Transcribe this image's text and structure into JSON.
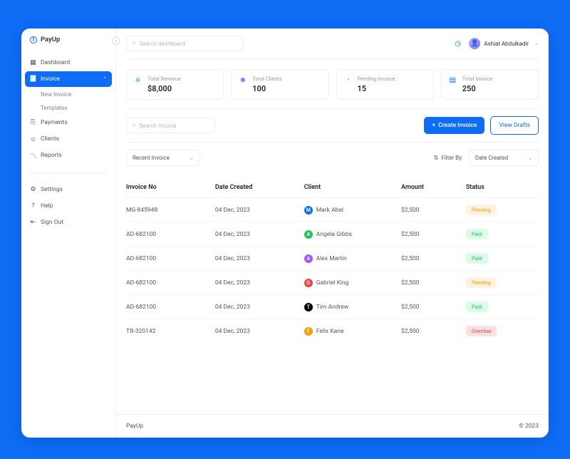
{
  "brand": "PayUp",
  "search": {
    "dashboard_placeholder": "Search dashboard",
    "invoice_placeholder": "Search Invoice"
  },
  "user": {
    "name": "Ashiat Abdulkadir"
  },
  "nav": {
    "dashboard": "Dashboard",
    "invoice": "Invoice",
    "sub": {
      "new": "New Invoice",
      "templates": "Templates"
    },
    "payments": "Payments",
    "clients": "Clients",
    "reports": "Reports",
    "settings": "Settings",
    "help": "Help",
    "signout": "Sign Out"
  },
  "stats": {
    "revenue": {
      "label": "Total Revenue",
      "value": "$8,000"
    },
    "clients": {
      "label": "Total Clients",
      "value": "100"
    },
    "pending": {
      "label": "Pending Invoice",
      "value": "15"
    },
    "total": {
      "label": "Total Invoice",
      "value": "250"
    }
  },
  "buttons": {
    "create": "Create Invoice",
    "drafts": "View Drafts"
  },
  "filters": {
    "recent": "Recent Invoice",
    "filter_by": "Filter By:",
    "date_created": "Date Created"
  },
  "table": {
    "headers": {
      "no": "Invoice No",
      "date": "Date Created",
      "client": "Client",
      "amount": "Amount",
      "status": "Status"
    },
    "rows": [
      {
        "no": "MG-845948",
        "date": "04 Dec, 2023",
        "client": "Mark Abel",
        "initial": "M",
        "avcls": "av-m",
        "amount": "$2,500",
        "status": "Pending",
        "statuscls": "badge-pending"
      },
      {
        "no": "AD-682100",
        "date": "04 Dec, 2023",
        "client": "Angela Gibbs",
        "initial": "A",
        "avcls": "av-a",
        "amount": "$2,500",
        "status": "Paid",
        "statuscls": "badge-paid"
      },
      {
        "no": "AD-682100",
        "date": "04 Dec, 2023",
        "client": "Alex Martin",
        "initial": "A",
        "avcls": "av-x",
        "amount": "$2,500",
        "status": "Paid",
        "statuscls": "badge-paid"
      },
      {
        "no": "AD-682100",
        "date": "04 Dec, 2023",
        "client": "Gabriel King",
        "initial": "G",
        "avcls": "av-g",
        "amount": "$2,500",
        "status": "Pending",
        "statuscls": "badge-pending"
      },
      {
        "no": "AD-682100",
        "date": "04 Dec, 2023",
        "client": "Tim Andrew",
        "initial": "T",
        "avcls": "av-t",
        "amount": "$2,500",
        "status": "Paid",
        "statuscls": "badge-paid"
      },
      {
        "no": "TB-320142",
        "date": "04 Dec, 2023",
        "client": "Felix Kane",
        "initial": "F",
        "avcls": "av-f",
        "amount": "$2,500",
        "status": "Overdue",
        "statuscls": "badge-overdue"
      }
    ]
  },
  "footer": {
    "brand": "PayUp",
    "copy": "© 2023"
  }
}
